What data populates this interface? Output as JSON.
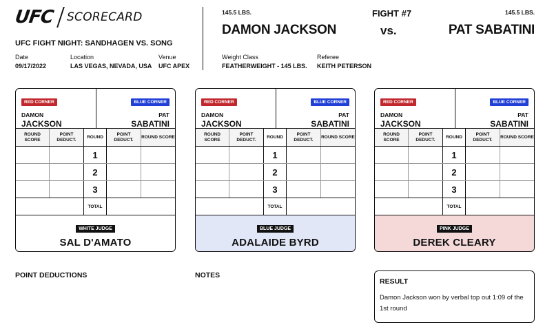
{
  "brand": {
    "logo_text": "UFC",
    "scorecard_label": "SCORECARD"
  },
  "event": {
    "name": "UFC FIGHT NIGHT: SANDHAGEN VS. SONG",
    "date_label": "Date",
    "date": "09/17/2022",
    "location_label": "Location",
    "location": "LAS VEGAS, NEVADA, USA",
    "venue_label": "Venue",
    "venue": "UFC APEX"
  },
  "fight": {
    "number": "FIGHT #7",
    "vs": "vs.",
    "red_weight": "145.5 LBS.",
    "blue_weight": "145.5 LBS.",
    "red_fighter": "DAMON JACKSON",
    "blue_fighter": "PAT SABATINI",
    "weight_class_label": "Weight Class",
    "weight_class": "FEATHERWEIGHT - 145 LBS.",
    "referee_label": "Referee",
    "referee": "KEITH PETERSON"
  },
  "scorecard_labels": {
    "red_corner": "RED CORNER",
    "blue_corner": "BLUE CORNER",
    "red_first": "DAMON",
    "red_last": "JACKSON",
    "blue_first": "PAT",
    "blue_last": "SABATINI",
    "round_score": "ROUND SCORE",
    "point_deduct": "POINT DEDUCT.",
    "round": "ROUND",
    "total": "TOTAL",
    "rounds": [
      "1",
      "2",
      "3"
    ]
  },
  "judges": [
    {
      "badge": "WHITE JUDGE",
      "name": "SAL D'AMATO",
      "bg": "#ffffff"
    },
    {
      "badge": "BLUE JUDGE",
      "name": "ADALAIDE BYRD",
      "bg": "#e2e7f8"
    },
    {
      "badge": "PINK JUDGE",
      "name": "DEREK CLEARY",
      "bg": "#f5d9d9"
    }
  ],
  "sections": {
    "point_deductions": "POINT DEDUCTIONS",
    "notes": "NOTES"
  },
  "result": {
    "title": "RESULT",
    "text": "Damon Jackson won by verbal top out 1:09 of the 1st round"
  },
  "colors": {
    "red_corner": "#c1272d",
    "blue_corner": "#1f3fd6"
  }
}
